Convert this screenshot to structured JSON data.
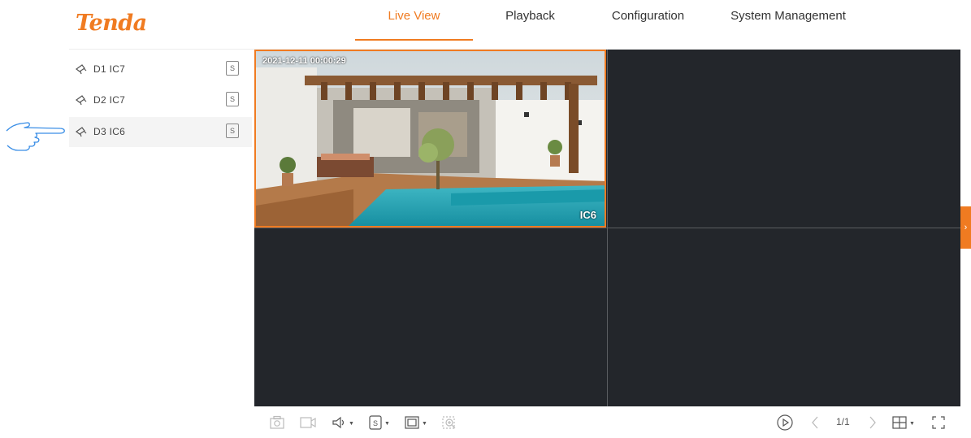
{
  "brand": {
    "logo": "Tenda",
    "accent_color": "#f07b21"
  },
  "nav": {
    "tabs": [
      {
        "label": "Live View",
        "active": true
      },
      {
        "label": "Playback",
        "active": false
      },
      {
        "label": "Configuration",
        "active": false
      },
      {
        "label": "System Management",
        "active": false
      }
    ]
  },
  "sidebar": {
    "cameras": [
      {
        "label": "D1 IC7",
        "icon": "camera-icon",
        "stream": "S",
        "selected": false
      },
      {
        "label": "D2 IC7",
        "icon": "camera-icon",
        "stream": "S",
        "selected": false
      },
      {
        "label": "D3 IC6",
        "icon": "camera-icon",
        "stream": "S",
        "selected": true
      }
    ]
  },
  "video": {
    "active_pane": {
      "timestamp": "2021-12-11 00:00:29",
      "camera_name": "IC6",
      "border_color": "#f07b21"
    },
    "background_color": "#23262b"
  },
  "toolbar": {
    "left_icons": [
      "snapshot-icon",
      "record-icon",
      "volume-icon",
      "stream-icon",
      "fullwindow-icon",
      "zoom-icon"
    ],
    "stream_label": "S",
    "page_indicator": "1/1",
    "right_icons": [
      "play-icon",
      "prev-page-icon",
      "next-page-icon",
      "layout-icon",
      "fullscreen-icon"
    ]
  },
  "side_tab": {
    "icon": "chevron-right-icon",
    "glyph": "›"
  }
}
